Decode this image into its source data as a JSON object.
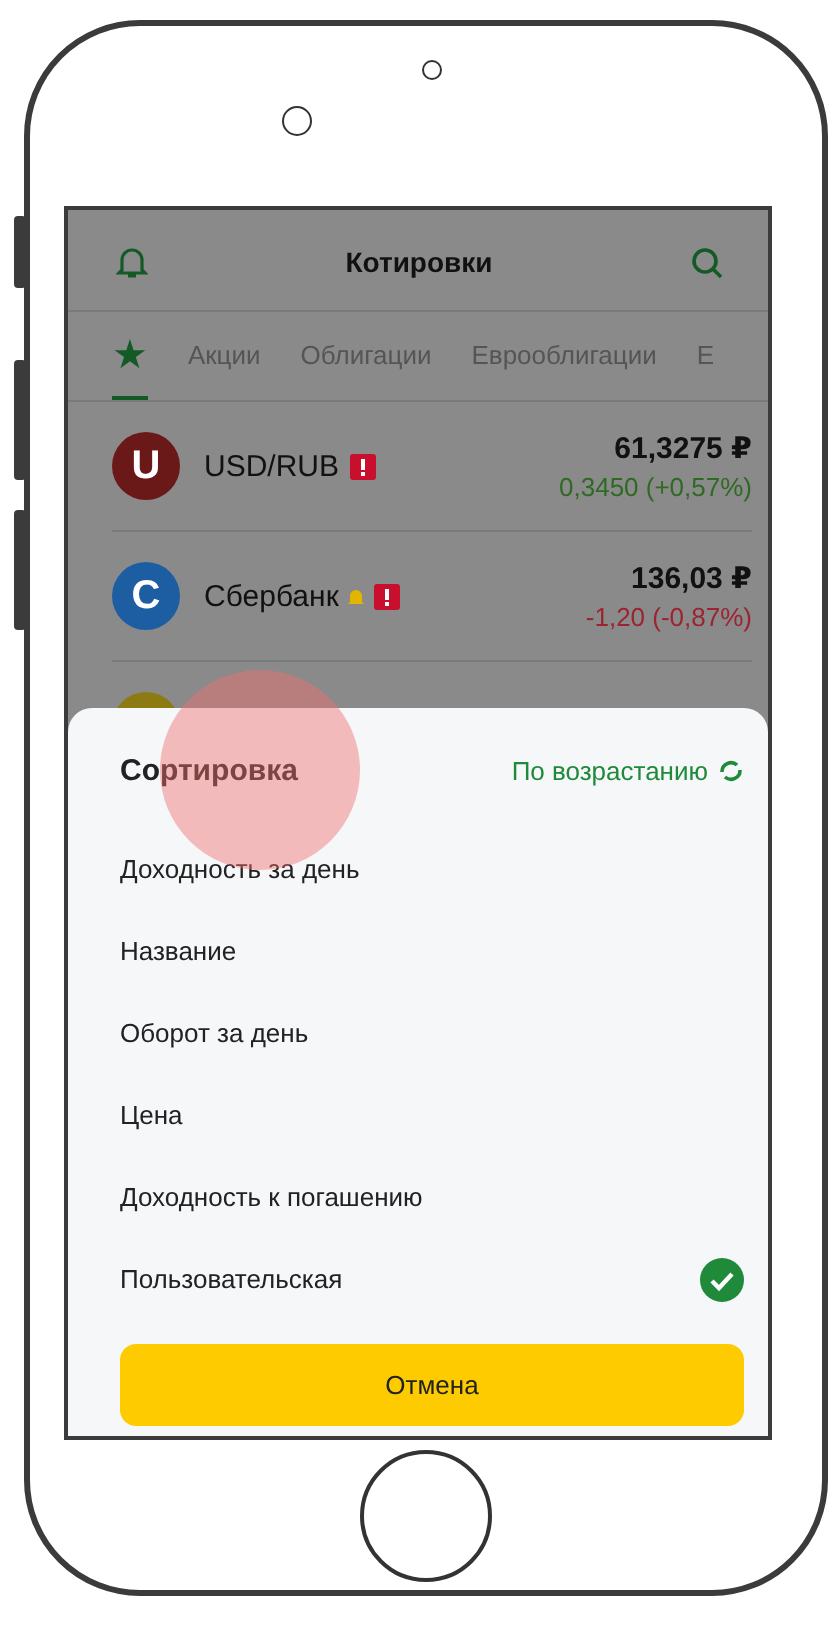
{
  "header": {
    "title": "Котировки"
  },
  "tabs": [
    {
      "label": "★",
      "kind": "icon",
      "selected": true
    },
    {
      "label": "Акции",
      "kind": "text",
      "selected": false
    },
    {
      "label": "Облигации",
      "kind": "text",
      "selected": false
    },
    {
      "label": "Еврооблигации",
      "kind": "text",
      "selected": false
    },
    {
      "label": "Е",
      "kind": "text",
      "selected": false
    }
  ],
  "quotes": [
    {
      "letter": "U",
      "color": "#6a1818",
      "name": "USD/RUB",
      "alert": false,
      "warning": true,
      "price": "61,3275 ₽",
      "change": {
        "text": "0,3450 (+0,57%)",
        "color": "#2f6a22"
      }
    },
    {
      "letter": "С",
      "color": "#1d5ea3",
      "name": "Сбербанк",
      "alert": true,
      "warning": true,
      "price": "136,03 ₽",
      "change": {
        "text": "-1,20 (-0,87%)",
        "color": "#9c2430"
      }
    },
    {
      "color": "#8c7a12"
    }
  ],
  "sheet": {
    "title": "Сортировка",
    "direction": "По возрастанию",
    "options": [
      {
        "label": "Доходность за день",
        "selected": false
      },
      {
        "label": "Название",
        "selected": false
      },
      {
        "label": "Оборот за день",
        "selected": false
      },
      {
        "label": "Цена",
        "selected": false
      },
      {
        "label": "Доходность к погашению",
        "selected": false
      },
      {
        "label": "Пользовательская",
        "selected": true
      }
    ],
    "cancel": "Отмена"
  }
}
